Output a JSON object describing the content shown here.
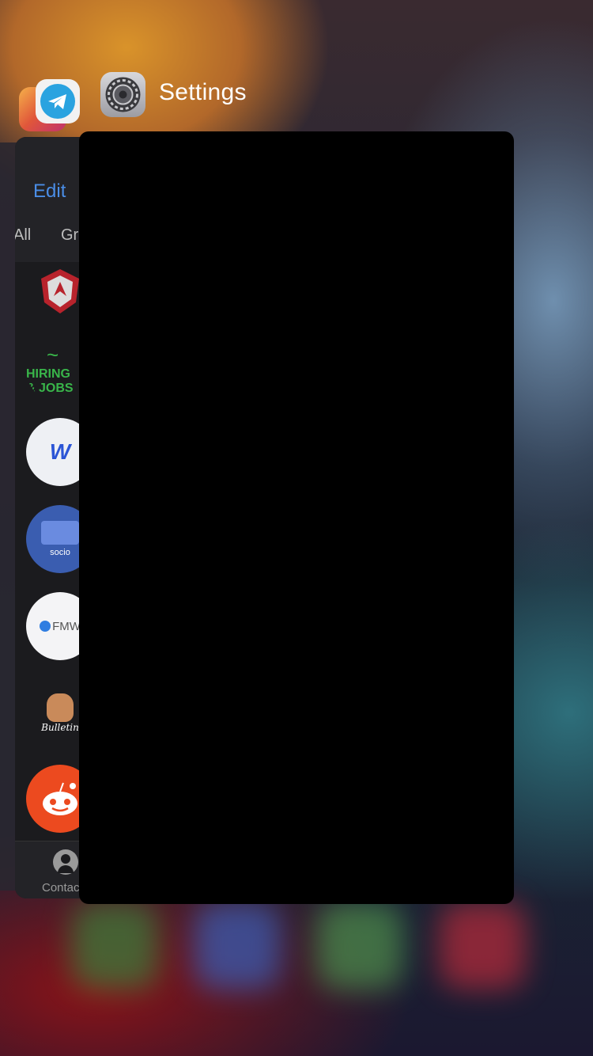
{
  "switcher": {
    "front_app_name": "Settings",
    "apps": [
      {
        "name": "Instagram",
        "icon": "instagram-icon"
      },
      {
        "name": "Telegram",
        "icon": "telegram-icon"
      },
      {
        "name": "Settings",
        "icon": "settings-gear-icon"
      }
    ]
  },
  "telegram_card": {
    "edit_label": "Edit",
    "tabs": [
      "All",
      "Gr"
    ],
    "chats": [
      {
        "icon": "shield-logo-icon"
      },
      {
        "text": "HIRING & JOBS"
      },
      {
        "text": "W"
      },
      {
        "text": "socio"
      },
      {
        "text": "FMW"
      },
      {
        "text": "Bulletin"
      },
      {
        "icon": "reddit-icon"
      }
    ],
    "bottom_tab_label": "Contac"
  },
  "colors": {
    "accent": "#4a8de6",
    "card_background": "#000000",
    "telegram_blue": "#2aa3e0"
  }
}
